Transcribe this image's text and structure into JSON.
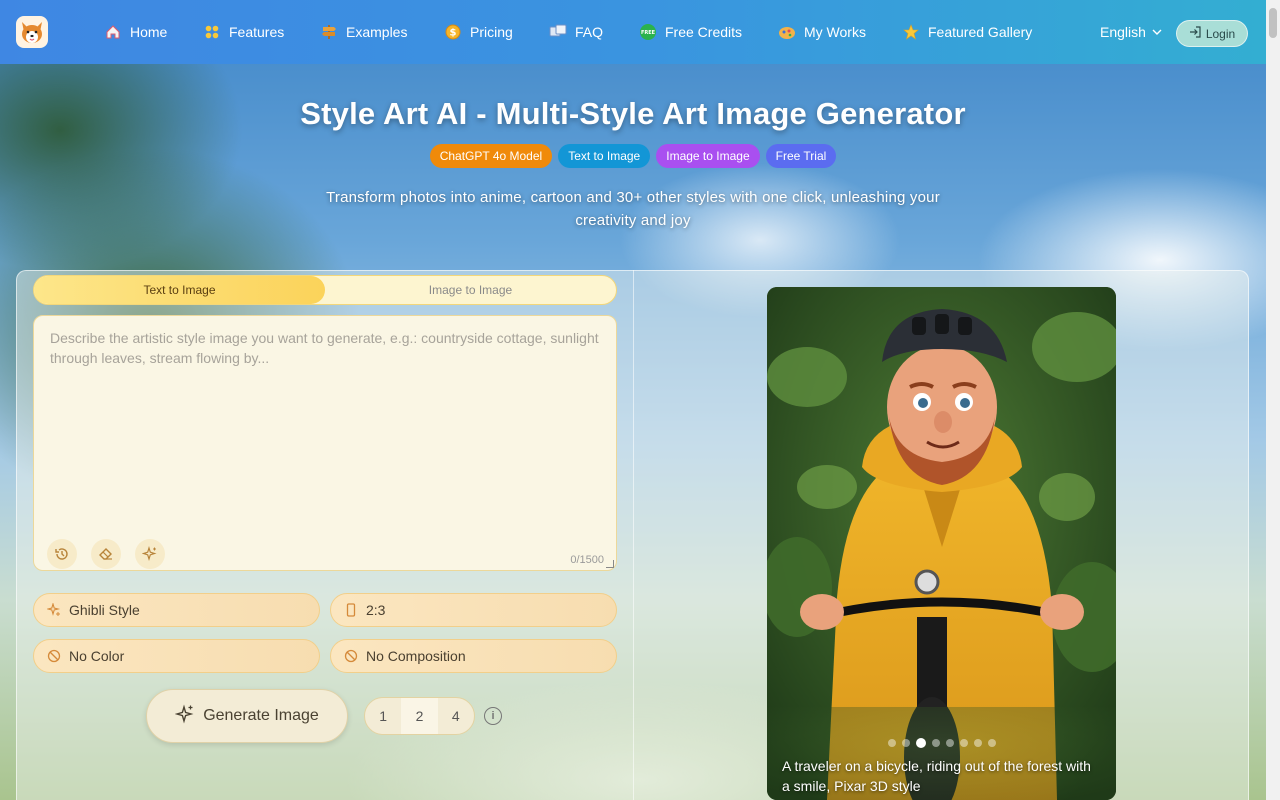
{
  "nav": {
    "items": [
      {
        "label": "Home",
        "icon": "home-icon"
      },
      {
        "label": "Features",
        "icon": "features-icon"
      },
      {
        "label": "Examples",
        "icon": "signpost-icon"
      },
      {
        "label": "Pricing",
        "icon": "coin-icon"
      },
      {
        "label": "FAQ",
        "icon": "faq-icon"
      },
      {
        "label": "Free Credits",
        "icon": "free-badge-icon"
      },
      {
        "label": "My Works",
        "icon": "works-icon"
      },
      {
        "label": "Featured Gallery",
        "icon": "star-icon"
      }
    ],
    "free_badge_text": "FREE",
    "language": "English",
    "login": "Login"
  },
  "hero": {
    "title": "Style Art AI - Multi-Style Art Image Generator",
    "badges": [
      {
        "label": "ChatGPT 4o Model",
        "color": "#f08a0a"
      },
      {
        "label": "Text to Image",
        "color": "#1396d6"
      },
      {
        "label": "Image to Image",
        "color": "#a94ff0"
      },
      {
        "label": "Free Trial",
        "color": "#5b6cf0"
      }
    ],
    "subtitle": "Transform photos into anime, cartoon and 30+ other styles with one click, unleashing your creativity and joy"
  },
  "editor": {
    "tabs": [
      "Text to Image",
      "Image to Image"
    ],
    "active_tab": "Text to Image",
    "prompt_placeholder": "Describe the artistic style image you want to generate, e.g.: countryside cottage, sunlight through leaves, stream flowing by...",
    "prompt_value": "",
    "char_count": "0/1500",
    "options": {
      "style": "Ghibli Style",
      "ratio": "2:3",
      "color": "No Color",
      "composition": "No Composition"
    },
    "generate_label": "Generate Image",
    "counts": [
      "1",
      "2",
      "4"
    ],
    "info_glyph": "i"
  },
  "preview": {
    "caption": "A traveler on a bicycle, riding out of the forest with a smile, Pixar 3D style",
    "slide_count": 8,
    "active_slide": 3
  },
  "colors": {
    "nav_start": "#3f87e3",
    "nav_end": "#33aed2",
    "accent": "#fbd35a"
  }
}
